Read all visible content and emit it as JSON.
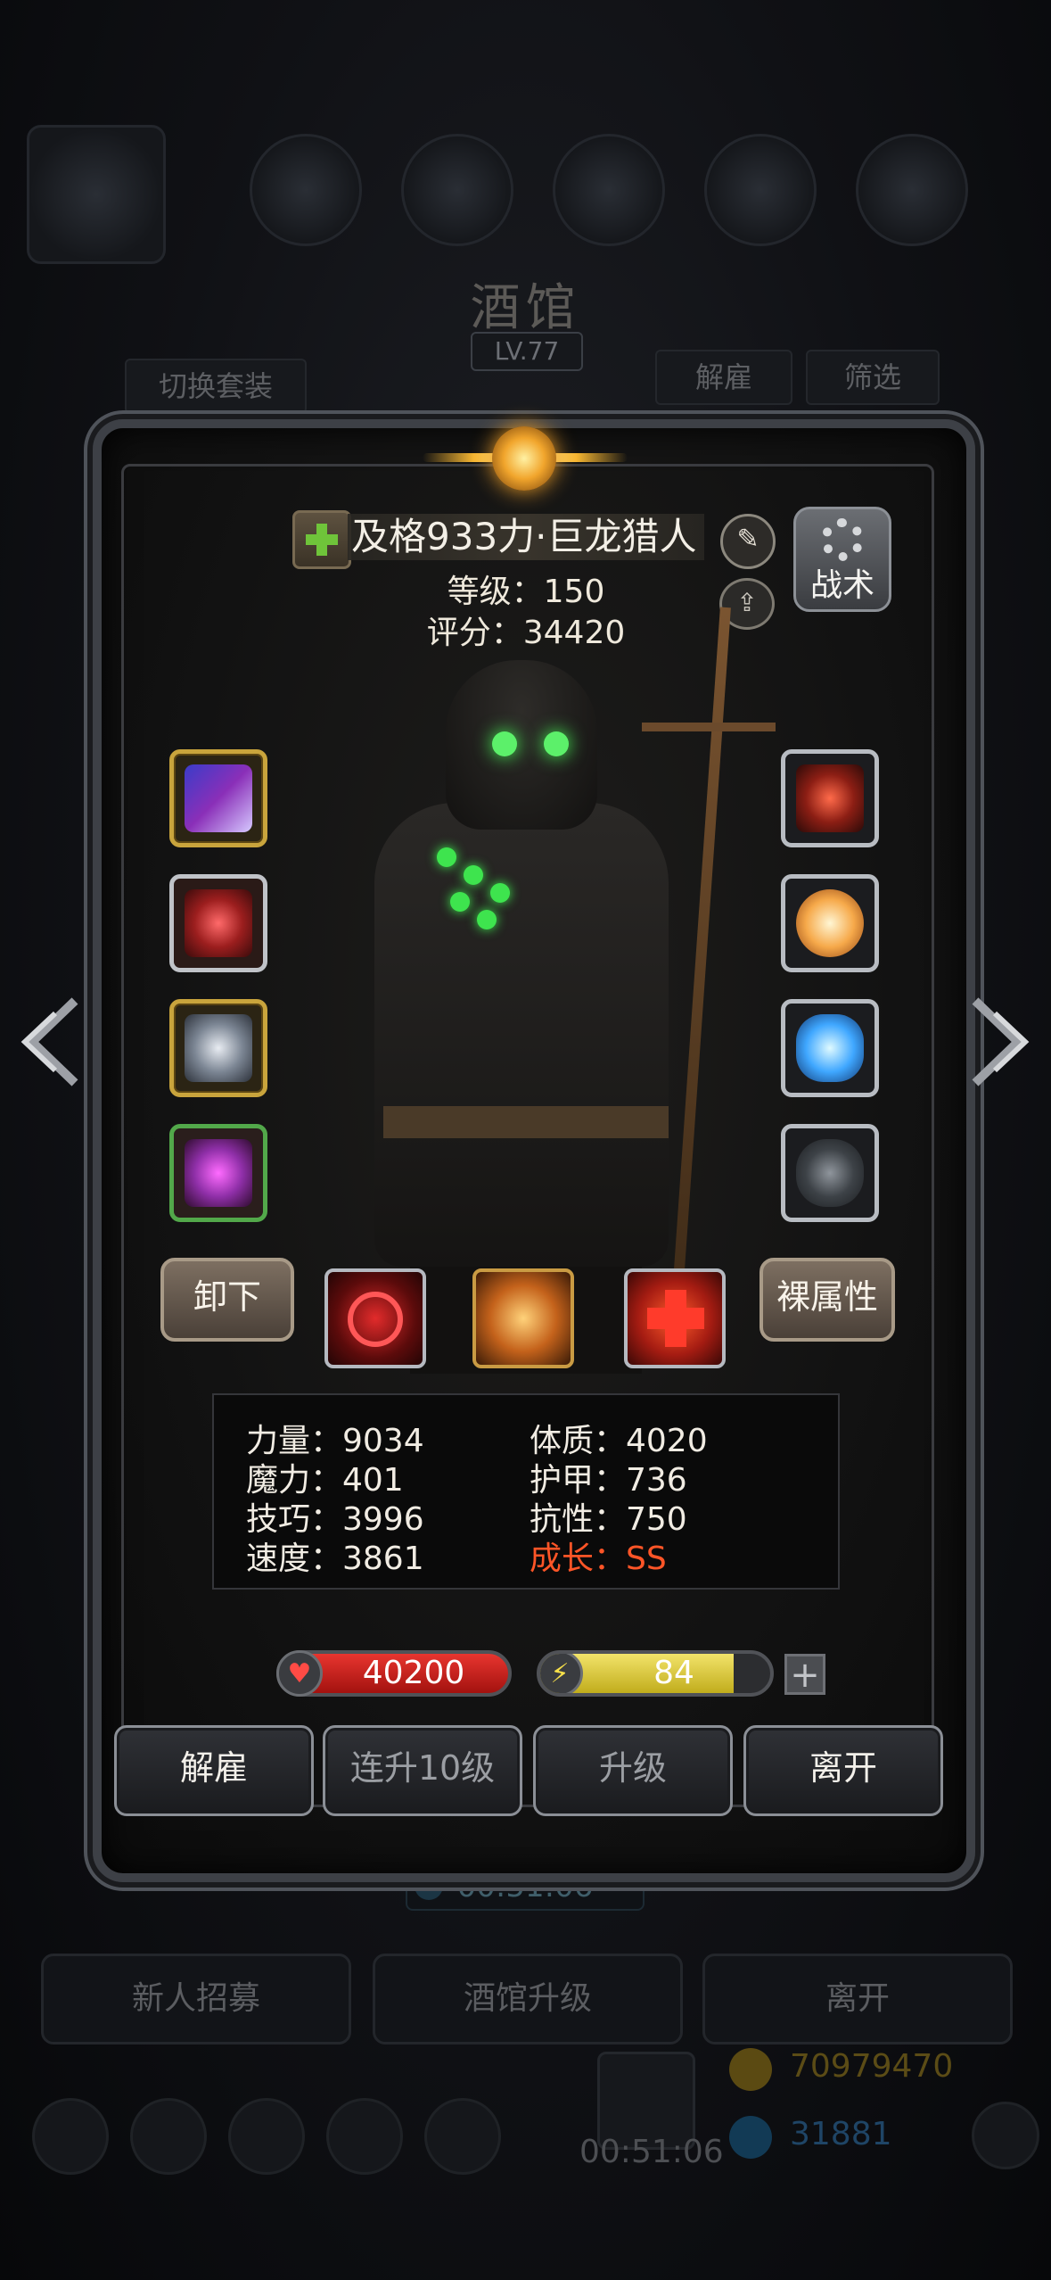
{
  "background": {
    "title": "酒馆",
    "level": "LV.77",
    "tab_switch_set": "切换套装",
    "tab_dismiss": "解雇",
    "tab_filter": "筛选",
    "timer": "00:51:06",
    "btn_recruit": "新人招募",
    "btn_upgrade_tavern": "酒馆升级",
    "btn_leave": "离开",
    "bottom_timer": "00:51:06",
    "gold": "70979470",
    "gems": "31881"
  },
  "hero": {
    "name": "及格933力·巨龙猎人",
    "level": "等级：150",
    "score": "评分：34420",
    "tactics_label": "战术"
  },
  "actions": {
    "unequip": "卸下",
    "raw_attributes": "裸属性"
  },
  "stats": {
    "strength": "力量：9034",
    "magic": "魔力：401",
    "skill": "技巧：3996",
    "speed": "速度：3861",
    "constitution": "体质：4020",
    "armor": "护甲：736",
    "resistance": "抗性：750",
    "growth": "成长：SS"
  },
  "bars": {
    "hp": "40200",
    "energy": "84",
    "energy_fill_percent": 84
  },
  "buttons": {
    "dismiss": "解雇",
    "level_up_10": "连升10级",
    "level_up": "升级",
    "leave": "离开"
  },
  "icons": {
    "plus": "plus-icon",
    "edit": "edit-icon",
    "upload": "upload-icon",
    "gear": "gear-icon",
    "nav_left": "chevron-left-icon",
    "nav_right": "chevron-right-icon",
    "heart": "heart-icon",
    "lightning": "lightning-icon"
  },
  "colors": {
    "growth": "#ff5527",
    "hp": "#e8352f",
    "energy": "#f2e36a",
    "accent_gold": "#c9a43c"
  }
}
